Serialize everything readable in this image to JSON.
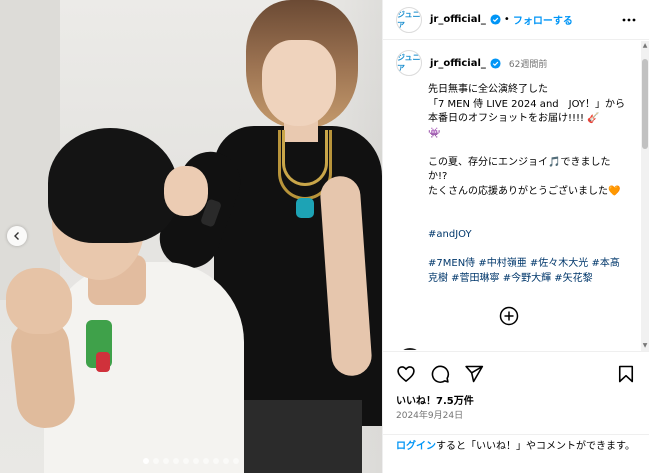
{
  "post": {
    "username": "jr_official_",
    "avatar_text": "ジュニア",
    "separator": "•",
    "follow_label": "フォローする",
    "time_ago": "62週間前",
    "caption": {
      "line1": "先日無事に全公演終了した\n「7 MEN 侍 LIVE 2024 and　JOY！」から\n本番日のオフショットをお届け!!!! 🎸\n👾",
      "line2": "この夏、存分にエンジョイ🎵できましたか!?\nたくさんの応援ありがとうございました🧡",
      "hashtags_line1": "#andJOY",
      "hashtags_line2": "#7MEN侍 #中村嶺亜 #佐々木大光 #本髙克樹 #菅田琳寧 #今野大輝 #矢花黎"
    },
    "likes": "いいね！7.5万件",
    "date": "2024年9月24日",
    "login_prompt": {
      "link": "ログイン",
      "text": "すると「いいね！」やコメントができます。"
    }
  },
  "carousel": {
    "slide_count": 10,
    "active_index": 0
  },
  "icons": {
    "verified": "verified-badge-icon",
    "more": "more-options-icon",
    "prev": "chevron-left-icon",
    "load_more": "plus-circle-icon",
    "like": "heart-icon",
    "comment": "comment-icon",
    "share": "share-icon",
    "save": "bookmark-icon"
  },
  "colors": {
    "accent": "#0095f6",
    "hashtag": "#00376b",
    "secondary_text": "#737373",
    "verified": "#0095f6"
  }
}
